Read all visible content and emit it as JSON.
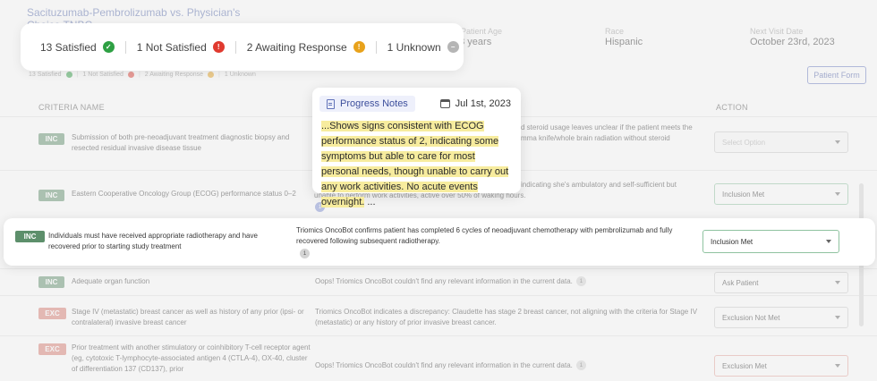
{
  "trial_tab": "Sacituzumab-Pembrolizumab vs. Physician's Choice TNBC",
  "patient_info": [
    {
      "label": "Patient Age",
      "value": "63 years"
    },
    {
      "label": "Race",
      "value": "Hispanic"
    },
    {
      "label": "Next Visit Date",
      "value": "October 23rd, 2023"
    }
  ],
  "status_summary": [
    {
      "text": "13 Satisfied",
      "icon": "check-icon",
      "color": "#2ea043"
    },
    {
      "text": "1 Not Satisfied",
      "icon": "alert-icon",
      "color": "#e03a2f"
    },
    {
      "text": "2 Awaiting Response",
      "icon": "alert-icon",
      "color": "#e8a21b"
    },
    {
      "text": "1 Unknown",
      "icon": "minus-icon",
      "color": "#b5b5b5"
    }
  ],
  "patient_form_label": "Patient Form",
  "columns": {
    "criteria": "CRITERIA NAME",
    "action": "ACTION"
  },
  "progress_notes": {
    "tab": "Progress Notes",
    "date": "Jul 1st, 2023",
    "text_highlight": "...Shows signs consistent with ECOG performance status of 2, indicating some symptoms but able to care for most personal needs, though unable to carry out any work activities. No acute events overnight.",
    "text_tail": " ..."
  },
  "rows": [
    {
      "type": "INC",
      "criteria": "Submission of both pre-neoadjuvant treatment diagnostic biopsy and resected residual invasive disease tissue",
      "evidence": "d steroid usage leaves unclear if the patient meets the mma knife/whole brain radiation without steroid",
      "cite": "",
      "action": "Select Option"
    },
    {
      "type": "INC",
      "criteria": "Eastern Cooperative Oncology Group (ECOG) performance status 0–2",
      "evidence_top": "indicating she's ambulatory and self-sufficient but",
      "evidence": "unable to perform work activities, active over 50% of waking hours.",
      "cite": "1",
      "action": "Inclusion Met"
    },
    {
      "type": "INC",
      "criteria": "Individuals must have received appropriate radiotherapy and have recovered prior to starting study treatment",
      "evidence": "Triomics OncoBot confirms patient has completed 6 cycles of neoadjuvant chemotherapy with pembrolizumab and fully recovered following subsequent radiotherapy.",
      "cite": "1",
      "action": "Inclusion Met"
    },
    {
      "type": "INC",
      "criteria": "Adequate organ function",
      "evidence": "Oops! Triomics OncoBot couldn't find any relevant information in the current data.",
      "cite": "1",
      "action": "Ask Patient"
    },
    {
      "type": "EXC",
      "criteria": "Stage IV (metastatic) breast cancer as well as history of any prior (ipsi- or contralateral) invasive breast cancer",
      "evidence": "Triomics OncoBot indicates a discrepancy: Claudette has stage 2 breast cancer, not aligning with the criteria for Stage IV (metastatic) or any history of prior invasive breast cancer.",
      "cite": "",
      "action": "Exclusion Not Met"
    },
    {
      "type": "EXC",
      "criteria": "Prior treatment with another stimulatory or coinhibitory T-cell receptor agent (eg, cytotoxic T-lymphocyte-associated antigen 4 (CTLA-4), OX-40, cluster of differentiation 137 (CD137), prior",
      "evidence": "Oops! Triomics OncoBot couldn't find any relevant information in the current data.",
      "cite": "1",
      "action": "Exclusion Met"
    }
  ]
}
